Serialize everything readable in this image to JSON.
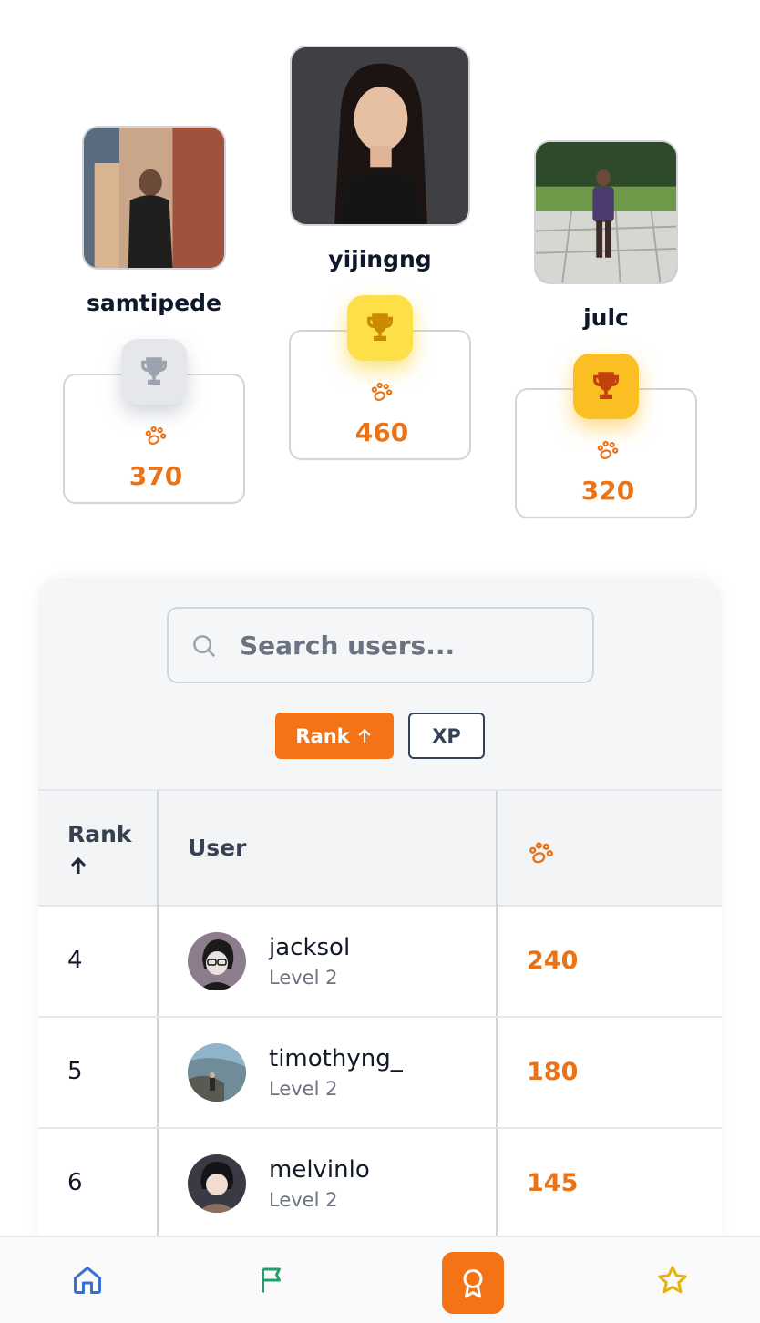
{
  "podium": [
    {
      "place": 2,
      "username": "samtipede",
      "score": "370",
      "trophy": "silver-trophy-icon",
      "trophy_color": "#9ca3af"
    },
    {
      "place": 1,
      "username": "yijingng",
      "score": "460",
      "trophy": "gold-trophy-icon",
      "trophy_color": "#ca8a04"
    },
    {
      "place": 3,
      "username": "julc",
      "score": "320",
      "trophy": "bronze-trophy-icon",
      "trophy_color": "#c2410c"
    }
  ],
  "search": {
    "placeholder": "Search users..."
  },
  "sort": {
    "rank_label": "Rank",
    "xp_label": "XP",
    "active": "rank"
  },
  "table": {
    "headers": {
      "rank": "Rank",
      "user": "User",
      "xp_icon": "paw-icon"
    },
    "rows": [
      {
        "rank": "4",
        "username": "jacksol",
        "level": "Level 2",
        "xp": "240"
      },
      {
        "rank": "5",
        "username": "timothyng_",
        "level": "Level 2",
        "xp": "180"
      },
      {
        "rank": "6",
        "username": "melvinlo",
        "level": "Level 2",
        "xp": "145"
      }
    ]
  },
  "nav": {
    "items": [
      "home-icon",
      "flag-icon",
      "award-icon",
      "star-icon"
    ],
    "active": "award-icon"
  },
  "colors": {
    "accent": "#f47316",
    "score": "#ea7317",
    "gold": "#fde047",
    "bronze": "#fbbf24",
    "silver": "#e5e7eb"
  }
}
